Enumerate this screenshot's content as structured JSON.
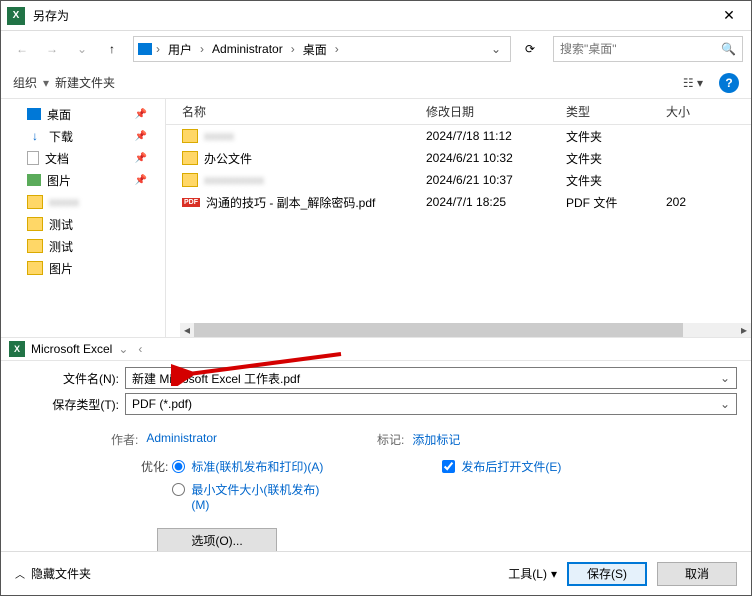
{
  "title": "另存为",
  "breadcrumb": {
    "seg1": "用户",
    "seg2": "Administrator",
    "seg3": "桌面"
  },
  "search": {
    "placeholder": "搜索\"桌面\""
  },
  "toolbar": {
    "organize": "组织",
    "new_folder": "新建文件夹"
  },
  "sidebar": {
    "items": [
      {
        "label": "桌面"
      },
      {
        "label": "下载"
      },
      {
        "label": "文档"
      },
      {
        "label": "图片"
      },
      {
        "label": ""
      },
      {
        "label": "测试"
      },
      {
        "label": "测试"
      },
      {
        "label": "图片"
      }
    ]
  },
  "path_indicator": "Microsoft Excel",
  "columns": {
    "name": "名称",
    "date": "修改日期",
    "type": "类型",
    "size": "大小"
  },
  "files": [
    {
      "name": "",
      "date": "2024/7/18 11:12",
      "type": "文件夹",
      "size": ""
    },
    {
      "name": "办公文件",
      "date": "2024/6/21 10:32",
      "type": "文件夹",
      "size": ""
    },
    {
      "name": "",
      "date": "2024/6/21 10:37",
      "type": "文件夹",
      "size": ""
    },
    {
      "name": "沟通的技巧 - 副本_解除密码.pdf",
      "date": "2024/7/1 18:25",
      "type": "PDF 文件",
      "size": "202"
    }
  ],
  "form": {
    "filename_label": "文件名(N):",
    "filename_value": "新建 Microsoft Excel 工作表.pdf",
    "filetype_label": "保存类型(T):",
    "filetype_value": "PDF (*.pdf)"
  },
  "meta": {
    "author_label": "作者:",
    "author_value": "Administrator",
    "tags_label": "标记:",
    "tags_value": "添加标记"
  },
  "optimize": {
    "label": "优化:",
    "standard": "标准(联机发布和打印)(A)",
    "minimum": "最小文件大小(联机发布)(M)",
    "open_after": "发布后打开文件(E)",
    "options_btn": "选项(O)..."
  },
  "footer": {
    "hide_folders": "隐藏文件夹",
    "tools": "工具(L)",
    "save": "保存(S)",
    "cancel": "取消"
  }
}
